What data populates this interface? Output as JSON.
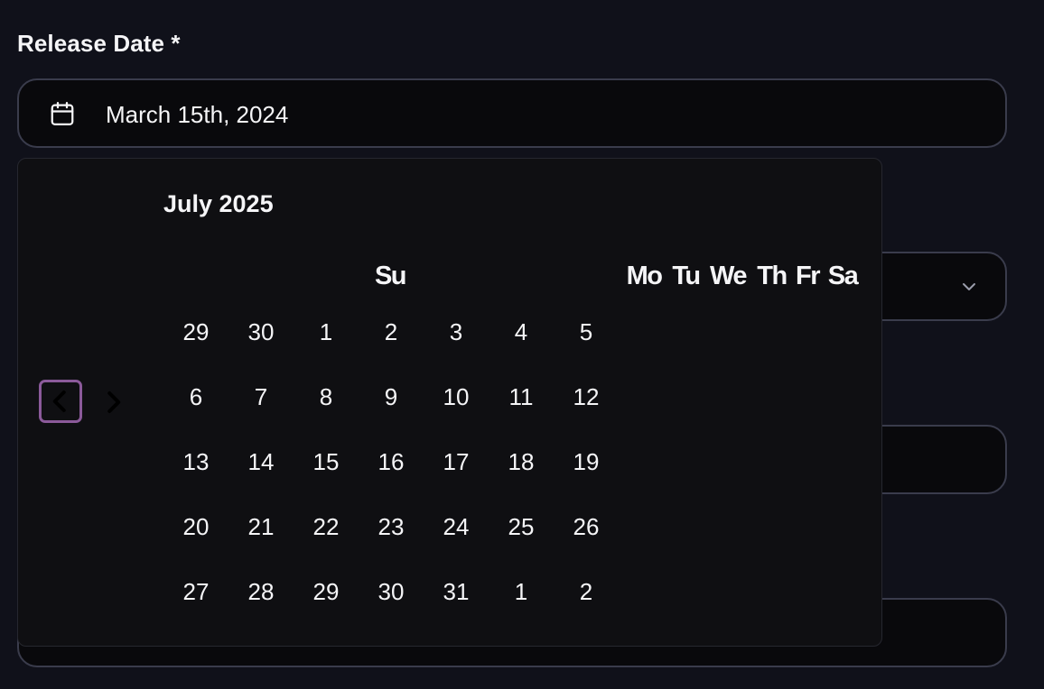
{
  "form": {
    "release_date_label": "Release Date *",
    "release_date_value": "March 15th, 2024"
  },
  "icons": {
    "trigger_icon": "calendar-icon",
    "prev_icon": "chevron-left-icon",
    "next_icon": "chevron-right-icon",
    "dropdown_icon": "chevron-down-icon"
  },
  "calendar": {
    "caption": "July 2025",
    "weekdays": [
      "Su",
      "Mo",
      "Tu",
      "We",
      "Th",
      "Fr",
      "Sa"
    ],
    "weeks": [
      [
        "29",
        "30",
        "1",
        "2",
        "3",
        "4",
        "5"
      ],
      [
        "6",
        "7",
        "8",
        "9",
        "10",
        "11",
        "12"
      ],
      [
        "13",
        "14",
        "15",
        "16",
        "17",
        "18",
        "19"
      ],
      [
        "20",
        "21",
        "22",
        "23",
        "24",
        "25",
        "26"
      ],
      [
        "27",
        "28",
        "29",
        "30",
        "31",
        "1",
        "2"
      ]
    ]
  },
  "colors": {
    "background": "#10111a",
    "field_border": "#3a3c4c",
    "focus_ring": "#8b5a9a",
    "text": "#f5f5f7"
  }
}
